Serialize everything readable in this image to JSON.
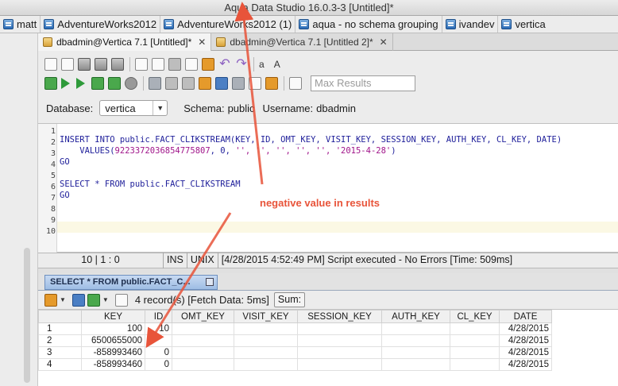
{
  "window": {
    "title": "Aqua Data Studio 16.0.3-3 [Untitled]*"
  },
  "favorites": [
    {
      "label": "matt"
    },
    {
      "label": "AdventureWorks2012"
    },
    {
      "label": "AdventureWorks2012 (1)"
    },
    {
      "label": "aqua - no schema grouping"
    },
    {
      "label": "ivandev"
    },
    {
      "label": "vertica"
    }
  ],
  "doc_tabs": [
    {
      "label": "dbadmin@Vertica 7.1 [Untitled]*",
      "close": "✕"
    },
    {
      "label": "dbadmin@Vertica 7.1 [Untitled 2]*",
      "close": "✕"
    }
  ],
  "toolbar": {
    "font_increase": "a",
    "font_decrease": "A",
    "max_results_placeholder": "Max Results"
  },
  "connection": {
    "database_label": "Database:",
    "database_value": "vertica",
    "schema_label": "Schema:",
    "schema_value": "public",
    "username_label": "Username:",
    "username_value": "dbadmin"
  },
  "editor": {
    "line_numbers": [
      "1",
      "2",
      "3",
      "4",
      "5",
      "6",
      "7",
      "8",
      "9",
      "10"
    ],
    "line1": "INSERT INTO public.FACT_CLIKSTREAM(KEY, ID, OMT_KEY, VISIT_KEY, SESSION_KEY, AUTH_KEY, CL_KEY, DATE)",
    "line2_a": "    VALUES(",
    "line2_num": "9223372036854775807",
    "line2_b": ", 0, ",
    "line2_str": "'', '', '', '', '', '2015-4-28'",
    "line2_c": ")",
    "line3": "GO",
    "line5": "SELECT * FROM public.FACT_CLIKSTREAM",
    "line6": "GO"
  },
  "statusbar": {
    "position": "10 | 1 : 0",
    "mode_ins": "INS",
    "mode_eol": "UNIX",
    "message": "[4/28/2015 4:52:49 PM] Script executed - No Errors [Time: 509ms]"
  },
  "results": {
    "tab_label": "SELECT * FROM public.FACT_C...",
    "fetch_info": "4 record(s) [Fetch Data: 5ms]",
    "sum_label": "Sum:",
    "columns": [
      "",
      "KEY",
      "ID",
      "OMT_KEY",
      "VISIT_KEY",
      "SESSION_KEY",
      "AUTH_KEY",
      "CL_KEY",
      "DATE"
    ],
    "rows": [
      [
        "1",
        "100",
        "10",
        "",
        "",
        "",
        "",
        "",
        "4/28/2015"
      ],
      [
        "2",
        "6500655000",
        "",
        "",
        "",
        "",
        "",
        "",
        "4/28/2015"
      ],
      [
        "3",
        "-858993460",
        "0",
        "",
        "",
        "",
        "",
        "",
        "4/28/2015"
      ],
      [
        "4",
        "-858993460",
        "0",
        "",
        "",
        "",
        "",
        "",
        "4/28/2015"
      ]
    ]
  },
  "annotation": {
    "text": "negative value in results",
    "color": "#e8543a"
  }
}
